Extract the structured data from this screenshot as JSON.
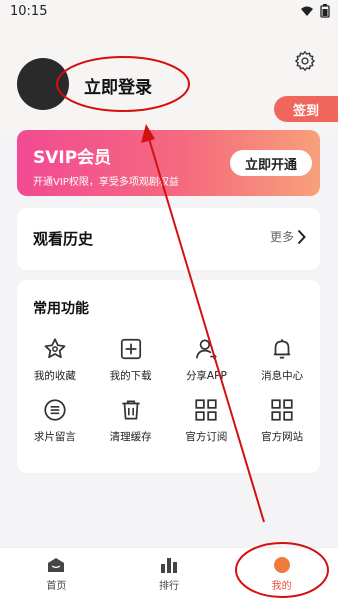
{
  "status": {
    "time": "10:15"
  },
  "profile": {
    "login": "立即登录",
    "checkin": "签到"
  },
  "svip": {
    "title": "SVIP会员",
    "subtitle": "开通VIP权限，享受多项观剧权益",
    "button": "立即开通"
  },
  "history": {
    "title": "观看历史",
    "more": "更多"
  },
  "functions": {
    "title": "常用功能",
    "items": [
      {
        "label": "我的收藏",
        "icon": "star-icon"
      },
      {
        "label": "我的下载",
        "icon": "download-icon"
      },
      {
        "label": "分享APP",
        "icon": "share-user-icon"
      },
      {
        "label": "消息中心",
        "icon": "bell-icon"
      },
      {
        "label": "求片留言",
        "icon": "message-list-icon"
      },
      {
        "label": "清理缓存",
        "icon": "trash-icon"
      },
      {
        "label": "官方订阅",
        "icon": "qr-icon"
      },
      {
        "label": "官方网站",
        "icon": "qr-site-icon"
      }
    ]
  },
  "tabs": [
    {
      "label": "首页",
      "icon": "home-icon"
    },
    {
      "label": "排行",
      "icon": "ranking-icon"
    },
    {
      "label": "我的",
      "icon": "profile-dot-icon"
    }
  ],
  "colors": {
    "accent": "#e84d3d",
    "annotation": "#d41010"
  }
}
